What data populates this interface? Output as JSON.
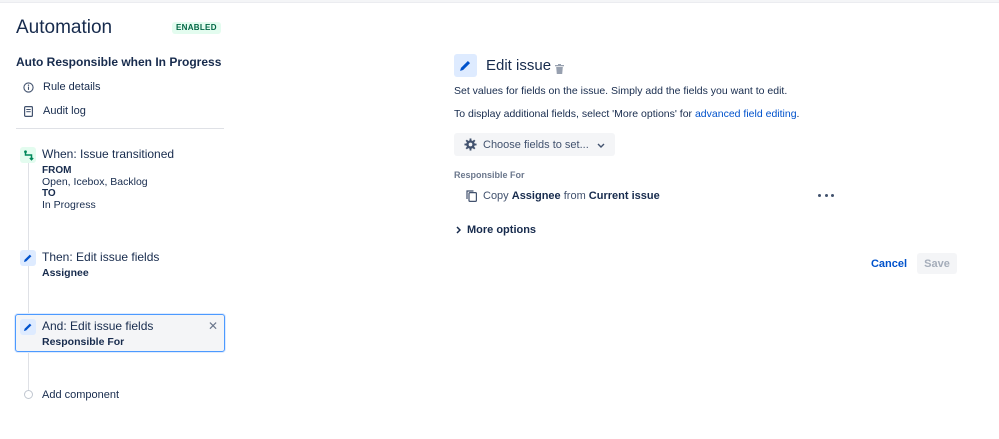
{
  "header": {
    "title": "Automation",
    "status_badge": "ENABLED"
  },
  "rule": {
    "name": "Auto Responsible when In Progress",
    "nav": [
      {
        "label": "Rule details",
        "icon": "info-icon"
      },
      {
        "label": "Audit log",
        "icon": "document-icon"
      }
    ],
    "components": {
      "trigger": {
        "title": "When: Issue transitioned",
        "from_label": "FROM",
        "from_value": "Open, Icebox, Backlog",
        "to_label": "TO",
        "to_value": "In Progress"
      },
      "action1": {
        "title": "Then: Edit issue fields",
        "subtitle": "Assignee"
      },
      "action2": {
        "title": "And: Edit issue fields",
        "subtitle": "Responsible For"
      }
    },
    "add_component_label": "Add component"
  },
  "editor": {
    "title": "Edit issue",
    "description": "Set values for fields on the issue. Simply add the fields you want to edit.",
    "more_info_prefix": "To display additional fields, select 'More options' for ",
    "more_info_link": "advanced field editing",
    "more_info_suffix": ".",
    "choose_fields_label": "Choose fields to set...",
    "field_label": "Responsible For",
    "copy_row": {
      "prefix": "Copy",
      "field": "Assignee",
      "middle": "from",
      "source": "Current issue"
    },
    "more_options_label": "More options",
    "cancel_label": "Cancel",
    "save_label": "Save"
  },
  "colors": {
    "accent": "#0052cc",
    "trigger_bg": "#e3fcef",
    "trigger_fg": "#00875a",
    "action_bg": "#deebff",
    "action_fg": "#0052cc",
    "selected_border": "#4c9aff"
  }
}
